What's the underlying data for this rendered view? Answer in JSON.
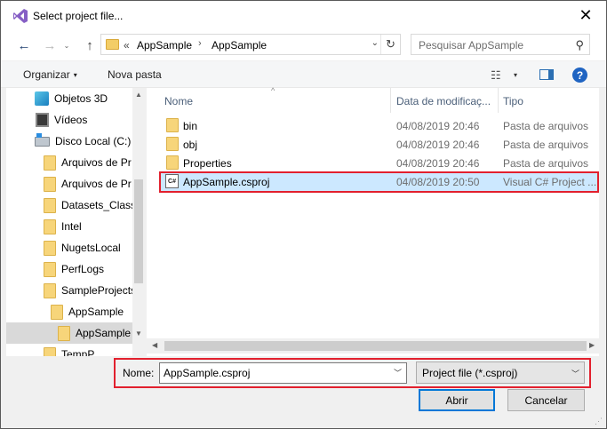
{
  "window": {
    "title": "Select project file...",
    "icon": "visual-studio-icon",
    "close_glyph": "✕"
  },
  "navigation": {
    "back_glyph": "←",
    "forward_glyph": "→",
    "history_glyph": "⌄",
    "up_glyph": "↑",
    "address": {
      "overflow": "«",
      "crumbs": [
        "AppSample",
        "AppSample"
      ],
      "separator": "›",
      "dropdown_glyph": "⌄",
      "refresh_glyph": "↻"
    },
    "search": {
      "placeholder": "Pesquisar AppSample",
      "icon_glyph": "⚲"
    }
  },
  "toolbar": {
    "organize_label": "Organizar",
    "new_folder_label": "Nova pasta",
    "caret": "▾",
    "view_glyph": "☷",
    "help_glyph": "?"
  },
  "tree": {
    "items": [
      {
        "label": "Objetos 3D",
        "icon": "3d-objects-icon"
      },
      {
        "label": "Vídeos",
        "icon": "videos-icon"
      },
      {
        "label": "Disco Local (C:)",
        "icon": "local-disk-icon"
      },
      {
        "label": "Arquivos de Pr",
        "icon": "folder-icon"
      },
      {
        "label": "Arquivos de Pr",
        "icon": "folder-icon"
      },
      {
        "label": "Datasets_Classi",
        "icon": "folder-icon"
      },
      {
        "label": "Intel",
        "icon": "folder-icon"
      },
      {
        "label": "NugetsLocal",
        "icon": "folder-icon"
      },
      {
        "label": "PerfLogs",
        "icon": "folder-icon"
      },
      {
        "label": "SampleProjects",
        "icon": "folder-icon"
      },
      {
        "label": "AppSample",
        "icon": "folder-icon"
      },
      {
        "label": "AppSample",
        "icon": "folder-icon",
        "selected": true
      },
      {
        "label": "TempP",
        "icon": "folder-icon"
      }
    ]
  },
  "filelist": {
    "columns": {
      "name": "Nome",
      "date": "Data de modificaç...",
      "type": "Tipo"
    },
    "rows": [
      {
        "name": "bin",
        "date": "04/08/2019 20:46",
        "type": "Pasta de arquivos",
        "icon": "folder-icon"
      },
      {
        "name": "obj",
        "date": "04/08/2019 20:46",
        "type": "Pasta de arquivos",
        "icon": "folder-icon"
      },
      {
        "name": "Properties",
        "date": "04/08/2019 20:46",
        "type": "Pasta de arquivos",
        "icon": "folder-icon"
      },
      {
        "name": "AppSample.csproj",
        "date": "04/08/2019 20:50",
        "type": "Visual C# Project ...",
        "icon": "csharp-project-icon",
        "selected": true
      }
    ],
    "csproj_icon_text": "C#"
  },
  "bottom": {
    "name_label": "Nome:",
    "name_value": "AppSample.csproj",
    "filter_value": "Project file (*.csproj)",
    "open_label": "Abrir",
    "cancel_label": "Cancelar"
  },
  "colors": {
    "highlight_border": "#e2202e",
    "selection": "#cce8ff",
    "accent": "#0078d7"
  }
}
